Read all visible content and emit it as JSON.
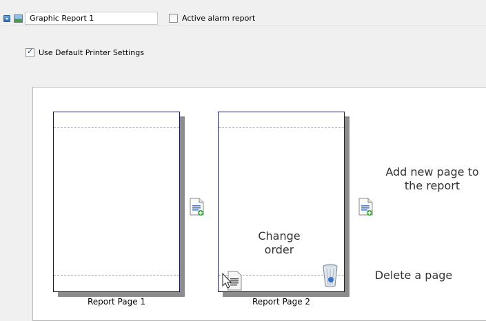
{
  "toolbar": {
    "collapse_icon": "collapse-toggle-icon",
    "graphic_icon": "graphic-report-icon",
    "report_name": "Graphic Report 1",
    "active_alarm_label": "Active alarm report",
    "active_alarm_checked": false
  },
  "settings": {
    "default_printer_label": "Use Default Printer Settings",
    "default_printer_checked": true
  },
  "pages": [
    {
      "label": "Report Page 1"
    },
    {
      "label": "Report Page 2"
    }
  ],
  "annotations": {
    "add_page": "Add new page to the report",
    "change_order": "Change order",
    "delete_page": "Delete a page"
  },
  "icons": {
    "add_page": "add-page-icon",
    "reorder": "reorder-page-icon",
    "delete": "recycle-bin-icon"
  },
  "colors": {
    "page_border": "#1a1a4a",
    "guide_line": "#9aa0d8",
    "shadow": "#8c8c8c",
    "add_plus": "#3aa83a"
  }
}
